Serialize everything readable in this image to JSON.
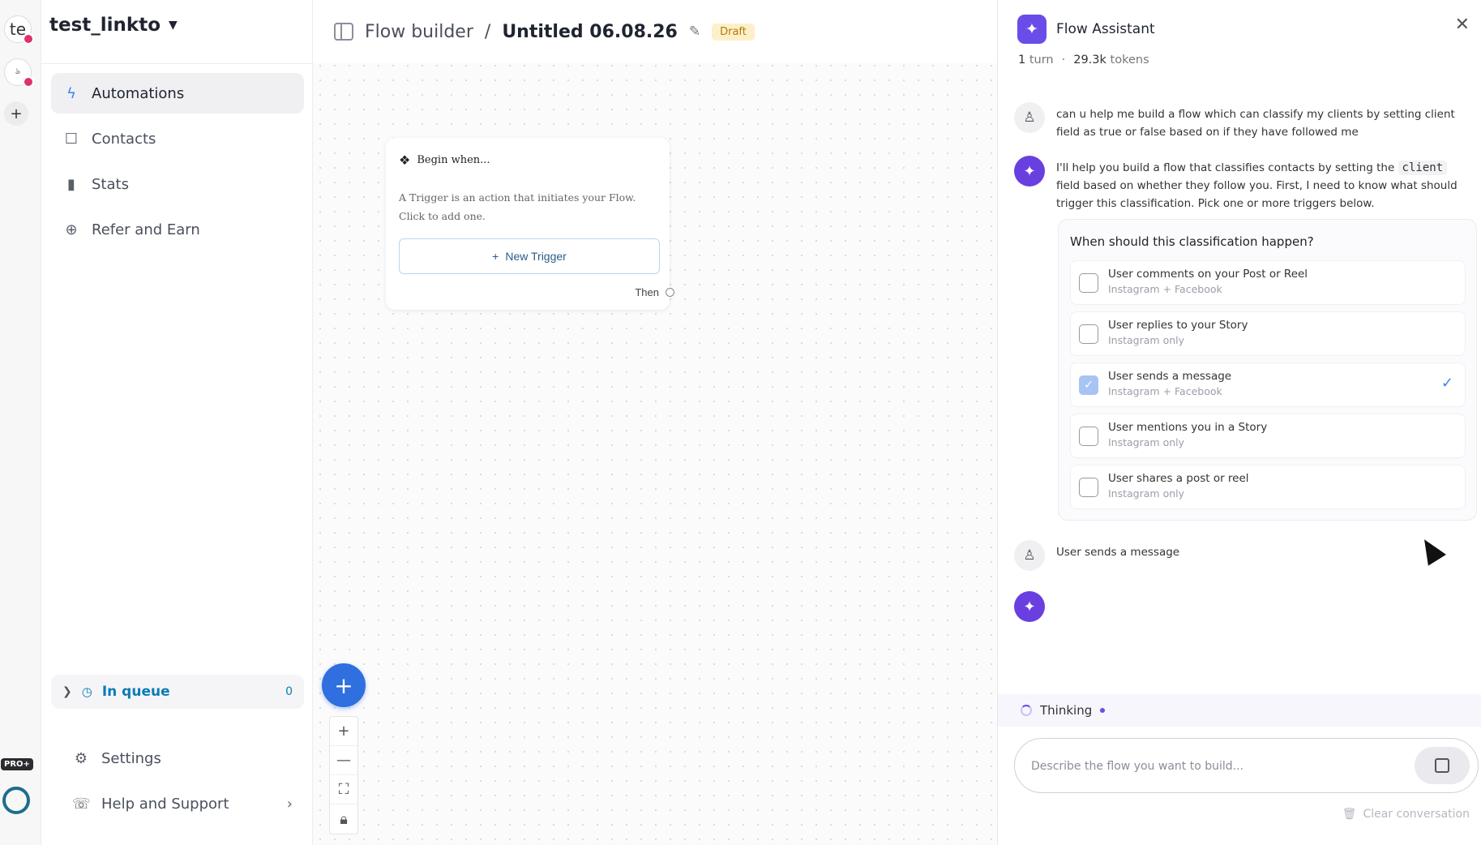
{
  "rail": {
    "account_initials": "te",
    "secondary_account": "ঌ",
    "add_label": "+",
    "pro_badge": "PRO+"
  },
  "sidebar": {
    "workspace": "test_linkto",
    "nav": [
      {
        "label": "Automations",
        "icon": "bolt-icon",
        "glyph": "ϟ"
      },
      {
        "label": "Contacts",
        "icon": "contact-card-icon",
        "glyph": "☐"
      },
      {
        "label": "Stats",
        "icon": "bar-chart-icon",
        "glyph": "▮"
      },
      {
        "label": "Refer and Earn",
        "icon": "globe-icon",
        "glyph": "⊕"
      }
    ],
    "queue": {
      "label": "In queue",
      "count": "0"
    },
    "settings_label": "Settings",
    "help_label": "Help and Support"
  },
  "topbar": {
    "section": "Flow builder",
    "separator": "/",
    "flow_title": "Untitled 06.08.26",
    "status": "Draft"
  },
  "trigger_card": {
    "heading": "Begin when...",
    "description": "A Trigger is an action that initiates your Flow. Click to add one.",
    "button_label": "New Trigger",
    "then_label": "Then"
  },
  "assistant": {
    "title": "Flow Assistant",
    "turns": "1",
    "turns_unit": "turn",
    "tokens": "29.3k",
    "tokens_unit": "tokens",
    "user_message_1": "can u help me build a flow which can classify my clients by setting client field as true or false based on if they have followed me",
    "bot_message_pre": "I'll help you build a flow that classifies contacts by setting the",
    "bot_message_code": "client",
    "bot_message_post": "field based on whether they follow you. First, I need to know what should trigger this classification. Pick one or more triggers below.",
    "question": "When should this classification happen?",
    "options": [
      {
        "title": "User comments on your Post or Reel",
        "sub": "Instagram + Facebook",
        "checked": false
      },
      {
        "title": "User replies to your Story",
        "sub": "Instagram only",
        "checked": false
      },
      {
        "title": "User sends a message",
        "sub": "Instagram + Facebook",
        "checked": true
      },
      {
        "title": "User mentions you in a Story",
        "sub": "Instagram only",
        "checked": false
      },
      {
        "title": "User shares a post or reel",
        "sub": "Instagram only",
        "checked": false
      }
    ],
    "user_message_2": "User sends a message",
    "thinking_label": "Thinking",
    "composer_placeholder": "Describe the flow you want to build...",
    "clear_label": "Clear conversation"
  },
  "colors": {
    "accent": "#6a4de8",
    "primary": "#2f6fdf",
    "queue": "#0b7bb5",
    "draft_bg": "#fdf0c9"
  }
}
